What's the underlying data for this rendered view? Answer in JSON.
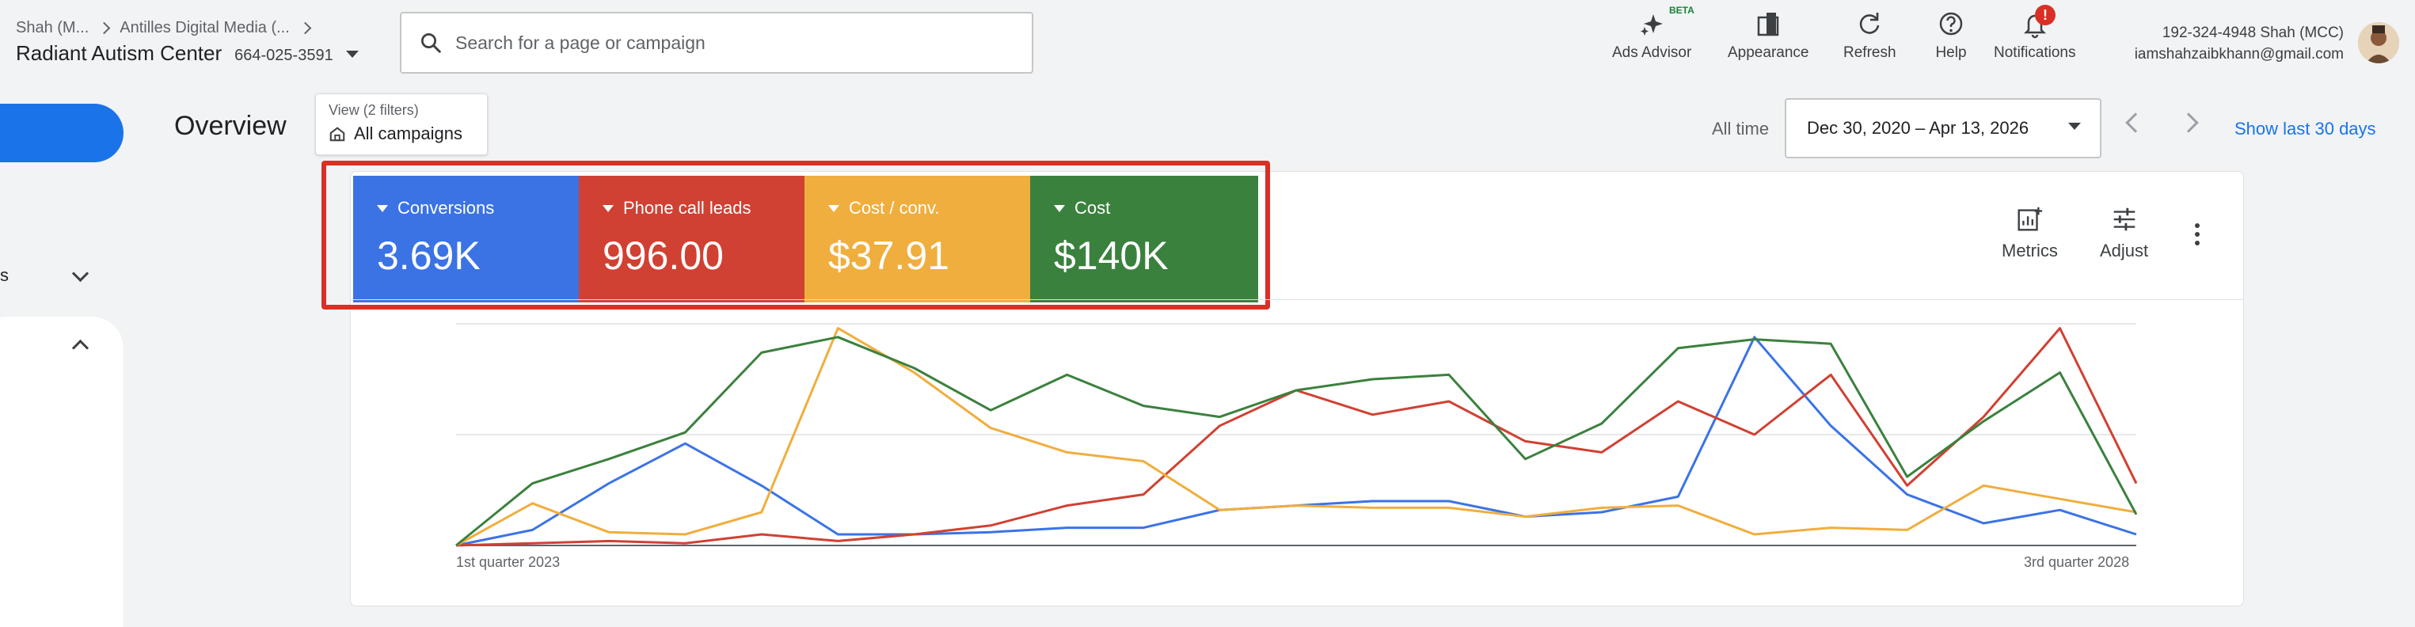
{
  "header": {
    "breadcrumb": [
      "Shah (M...",
      "Antilles Digital Media (..."
    ],
    "account_name": "Radiant Autism Center",
    "account_id": "664-025-3591",
    "search_placeholder": "Search for a page or campaign",
    "tools": [
      {
        "label": "Ads Advisor",
        "icon": "sparkle-icon"
      },
      {
        "label": "Appearance",
        "icon": "appearance-icon"
      },
      {
        "label": "Refresh",
        "icon": "refresh-icon"
      },
      {
        "label": "Help",
        "icon": "help-icon"
      },
      {
        "label": "Notifications",
        "icon": "bell-icon"
      }
    ],
    "beta_label": "BETA",
    "notification_badge": "!",
    "user_line1": "192-324-4948 Shah (MCC)",
    "user_line2": "iamshahzaibkhann@gmail.com"
  },
  "left_rail": {
    "partial_label": "s"
  },
  "overview": {
    "title": "Overview",
    "view_filters": "View (2 filters)",
    "view_value": "All campaigns",
    "date_label": "All time",
    "date_range": "Dec 30, 2020 – Apr 13, 2026",
    "show_last": "Show last 30 days"
  },
  "scorecards": [
    {
      "label": "Conversions",
      "value": "3.69K",
      "color": "#3b73e5"
    },
    {
      "label": "Phone call leads",
      "value": "996.00",
      "color": "#d04133"
    },
    {
      "label": "Cost / conv.",
      "value": "$37.91",
      "color": "#f0ae3e"
    },
    {
      "label": "Cost",
      "value": "$140K",
      "color": "#3b813e"
    }
  ],
  "chart_controls": {
    "metrics": "Metrics",
    "adjust": "Adjust"
  },
  "chart_data": {
    "type": "line",
    "x_start_label": "1st quarter 2023",
    "x_end_label": "3rd quarter 2028",
    "ylim": [
      0,
      100
    ],
    "grid": true,
    "series": [
      {
        "name": "Conversions",
        "color": "#3b73e5",
        "values": [
          0,
          7,
          28,
          46,
          27,
          5,
          5,
          6,
          8,
          8,
          16,
          18,
          20,
          20,
          13,
          15,
          22,
          94,
          54,
          23,
          10,
          16,
          5
        ]
      },
      {
        "name": "Phone call leads",
        "color": "#d04133",
        "values": [
          0,
          1,
          2,
          1,
          5,
          2,
          5,
          9,
          18,
          23,
          54,
          70,
          59,
          65,
          47,
          42,
          65,
          50,
          77,
          27,
          58,
          98,
          28
        ]
      },
      {
        "name": "Cost / conv.",
        "color": "#f0ae3e",
        "values": [
          0,
          19,
          6,
          5,
          15,
          98,
          78,
          53,
          42,
          38,
          16,
          18,
          17,
          17,
          13,
          17,
          18,
          5,
          8,
          7,
          27,
          21,
          15
        ]
      },
      {
        "name": "Cost",
        "color": "#3b813e",
        "values": [
          0,
          28,
          39,
          51,
          87,
          94,
          80,
          61,
          77,
          63,
          58,
          70,
          75,
          77,
          39,
          55,
          89,
          93,
          91,
          31,
          56,
          78,
          14
        ]
      }
    ]
  }
}
